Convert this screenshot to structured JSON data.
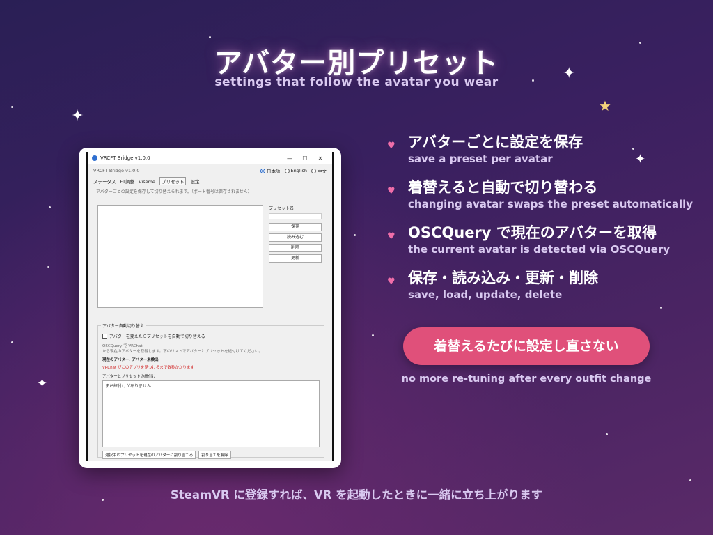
{
  "title": "アバター別プリセット",
  "subtitle": "settings that follow the avatar you wear",
  "app": {
    "window_title": "VRCFT Bridge v1.0.0",
    "header_name": "VRCFT Bridge v1.0.0",
    "languages": [
      "日本語",
      "English",
      "中文"
    ],
    "selected_language": "日本語",
    "tabs": [
      "ステータス",
      "FT調整",
      "Viseme",
      "プリセット",
      "設定"
    ],
    "selected_tab": "プリセット",
    "description": "アバターごとの設定を保存して切り替えられます。（ポート番号は保存されません）",
    "preset_name_label": "プリセット名",
    "buttons": [
      "保存",
      "読み込む",
      "削除",
      "更新"
    ],
    "group_title": "アバター自動切り替え",
    "auto_switch_label": "アバターを変えたらプリセットを自動で切り替える",
    "osc_line1": "OSCQuery で VRChat",
    "osc_line2": "から現在のアバターを取得します。下のリストでアバターとプリセットを紐付けてください。",
    "current_avatar": "現在のアバター: アバター未検出",
    "warning": "VRChat がこのアプリを見つけるまで数秒かかります",
    "assign_label": "アバターとプリセットの紐付け",
    "assign_empty": "まだ紐付けがありません",
    "assign_button": "選択中のプリセットを現在のアバターに割り当てる",
    "unassign_button": "割り当てを解除"
  },
  "features": [
    {
      "title": "アバターごとに設定を保存",
      "sub": "save a preset per avatar"
    },
    {
      "title": "着替えると自動で切り替わる",
      "sub": "changing avatar swaps the preset automatically"
    },
    {
      "title": "OSCQuery で現在のアバターを取得",
      "sub": "the current avatar is detected via OSCQuery"
    },
    {
      "title": "保存・読み込み・更新・削除",
      "sub": "save, load, update, delete"
    }
  ],
  "cta": "着替えるたびに設定し直さない",
  "cta_sub": "no more re-tuning after every outfit change",
  "footer": "SteamVR に登録すれば、VR を起動したときに一緒に立ち上がります",
  "colors": {
    "accent": "#e0507a",
    "heart": "#f06ea9",
    "star_gold": "#f3d27a"
  }
}
